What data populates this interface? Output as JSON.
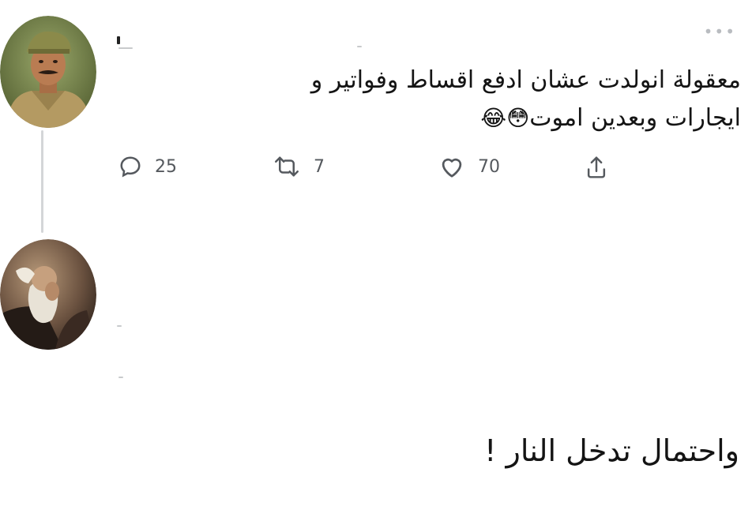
{
  "tweet": {
    "text_line1": "معقولة انولدت عشان ادفع اقساط وفواتير و",
    "text_line2": "ايجارات وبعدين اموت",
    "emojis": "😳😂",
    "actions": {
      "replies": "25",
      "retweets": "7",
      "likes": "70"
    },
    "more_icon": "more-horizontal-icon"
  },
  "reply": {
    "text": "واحتمال تدخل النار !"
  },
  "icons": {
    "reply": "speech-bubble-icon",
    "retweet": "retweet-icon",
    "like": "heart-icon",
    "share": "share-icon"
  },
  "colors": {
    "icon_gray": "#55595e",
    "text": "#141414",
    "thread_line": "#d4d6d8"
  }
}
